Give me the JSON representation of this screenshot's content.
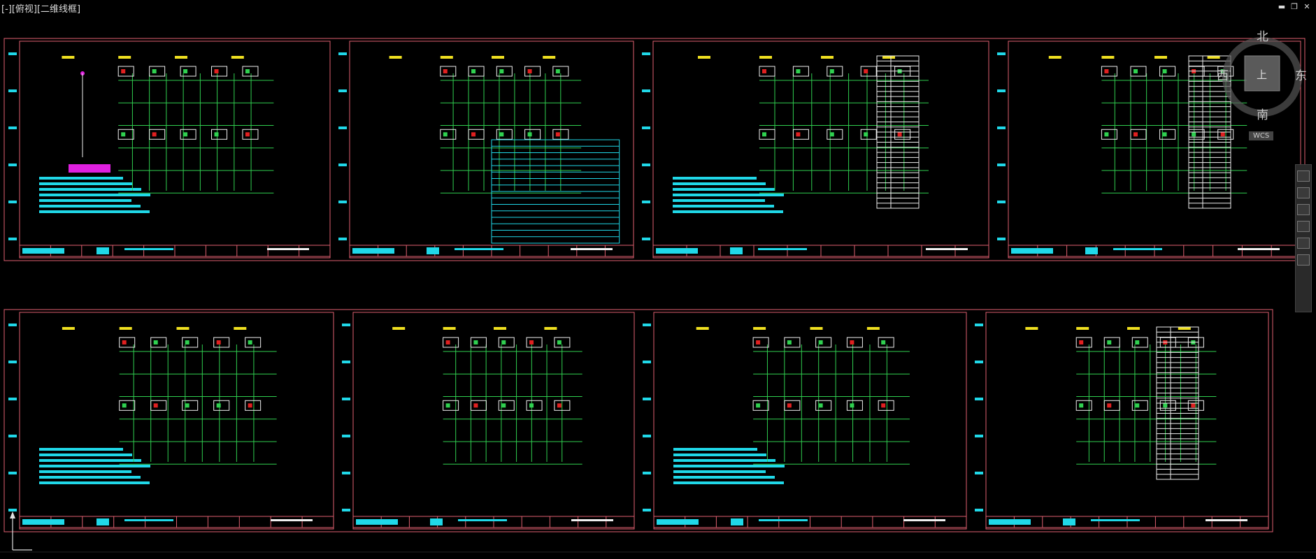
{
  "viewport": {
    "label": "[-][俯视][二维线框]"
  },
  "window_controls": {
    "minimize": "▬",
    "restore": "❐",
    "close": "✕"
  },
  "viewcube": {
    "north": "北",
    "south": "南",
    "east": "东",
    "west": "西",
    "top_face": "上",
    "wcs": "WCS"
  },
  "colors": {
    "background": "#000000",
    "frame": "#e06070",
    "line_green": "#30d050",
    "cyan": "#20d8e8",
    "yellow": "#f0e020",
    "white": "#f0f0f0",
    "red": "#e02020",
    "magenta": "#e020e0"
  },
  "sheets_row_count": 2,
  "sheets_per_row": 4
}
